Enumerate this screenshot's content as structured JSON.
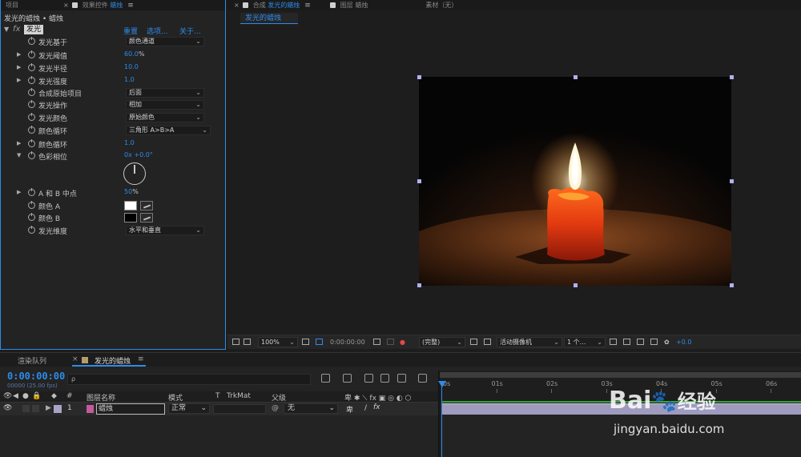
{
  "effect_controls": {
    "tabs": {
      "project": "项目",
      "effect_controls": "效果控件",
      "effect_controls_target": "蜡烛"
    },
    "header": "发光的蜡烛 • 蜡烛",
    "effect": {
      "name": "发光",
      "reset": "重置",
      "options": "选项...",
      "about": "关于..."
    },
    "properties": {
      "glow_based_on": {
        "name": "发光基于",
        "value": "颜色通道"
      },
      "glow_threshold": {
        "name": "发光阈值",
        "value": "60.0",
        "unit": "%"
      },
      "glow_radius": {
        "name": "发光半径",
        "value": "10.0"
      },
      "glow_intensity": {
        "name": "发光强度",
        "value": "1.0"
      },
      "composite_original": {
        "name": "合成原始项目",
        "value": "后面"
      },
      "glow_operation": {
        "name": "发光操作",
        "value": "相加"
      },
      "glow_colors": {
        "name": "发光颜色",
        "value": "原始颜色"
      },
      "color_looping": {
        "name": "颜色循环",
        "value": "三角形 A>B>A"
      },
      "color_loops": {
        "name": "颜色循环",
        "value": "1.0"
      },
      "color_phase": {
        "name": "色彩相位",
        "value": "0x +0.0°"
      },
      "ab_midpoint": {
        "name": "A 和 B 中点",
        "value": "50",
        "unit": "%"
      },
      "color_a": {
        "name": "颜色 A",
        "color": "#ffffff"
      },
      "color_b": {
        "name": "颜色 B",
        "color": "#000000"
      },
      "glow_dimensions": {
        "name": "发光维度",
        "value": "水平和垂直"
      }
    }
  },
  "composition": {
    "tabs": {
      "comp_prefix": "合成",
      "comp_name": "发光的蜡烛",
      "layer_prefix": "图层",
      "layer_name": "蜡烛",
      "footage": "素材（无）"
    },
    "subtab": "发光的蜡烛",
    "toolbar": {
      "zoom": "100%",
      "timecode": "0:00:00:00",
      "resolution": "(完整)",
      "camera": "活动摄像机",
      "views": "1 个...",
      "exposure": "+0.0"
    }
  },
  "timeline": {
    "tabs": {
      "render_queue": "渲染队列",
      "comp_name": "发光的蜡烛"
    },
    "timecode": "0:00:00:00",
    "fps_readout": "00000 (25.00 fps)",
    "search_placeholder": "ρ",
    "columns": {
      "number": "#",
      "layer_name": "图层名称",
      "mode": "模式",
      "t": "T",
      "trkmat": "TrkMat",
      "parent": "父级"
    },
    "layers": [
      {
        "index": "1",
        "name": "蜡烛",
        "mode": "正常",
        "parent": "无",
        "label_color": "#a9a3c8"
      }
    ],
    "ruler_ticks": [
      "0s",
      "01s",
      "02s",
      "03s",
      "04s",
      "05s",
      "06s"
    ]
  },
  "watermark": {
    "brand": "Bai",
    "brand2": "经验",
    "url": "jingyan.baidu.com"
  },
  "colors": {
    "accent_blue": "#2d8ceb",
    "layer_bar": "#9e9bbf",
    "work_area": "#36a336"
  }
}
